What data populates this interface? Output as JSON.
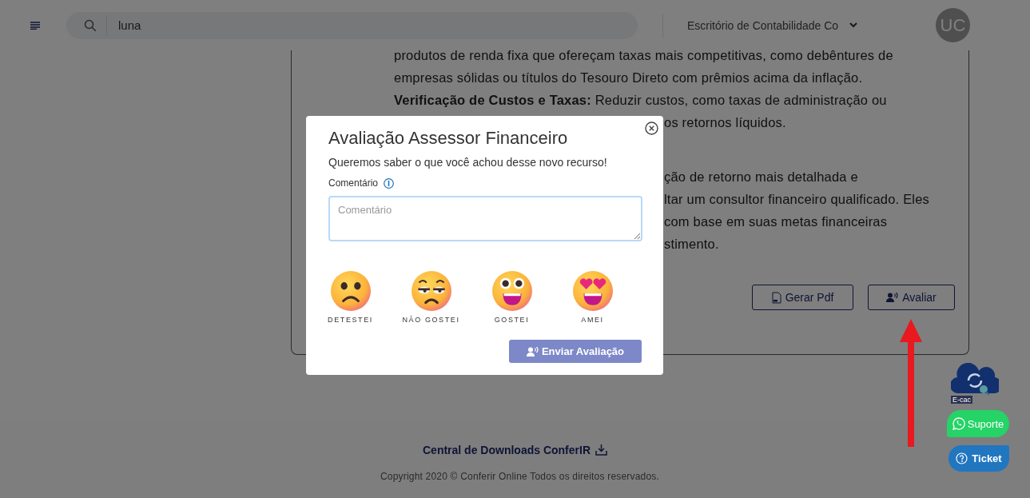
{
  "header": {
    "search": {
      "value": "luna"
    },
    "company_select": {
      "value": "Escritório de Contabilidade Co"
    },
    "avatar": {
      "initials": "UC"
    }
  },
  "article": {
    "lines": [
      {
        "kind": "full",
        "text": "produtos de renda fixa que ofereçam taxas mais competitivas, como debêntures de"
      },
      {
        "kind": "full",
        "text": "empresas sólidas ou títulos do Tesouro Direto com prêmios acima da inflação."
      },
      {
        "kind": "full",
        "text": "**Verificação de Custos e Taxas:** Reduzir custos, como taxas de administração ou"
      },
      {
        "kind": "partial",
        "text": "os retornos líquidos."
      },
      {
        "kind": "break"
      },
      {
        "kind": "partial",
        "text": "ção de retorno mais detalhada e"
      },
      {
        "kind": "partial",
        "text": "ltar um consultor financeiro qualificado. Eles"
      },
      {
        "kind": "partial",
        "text": "com base em suas metas financeiras"
      },
      {
        "kind": "partial",
        "text": "stimento."
      }
    ],
    "actions": [
      {
        "kind": "pdf",
        "label": "Gerar Pdf"
      },
      {
        "kind": "rate",
        "label": "Avaliar"
      }
    ]
  },
  "modal": {
    "title": "Avaliação Assessor Financeiro",
    "subtitle": "Queremos saber o que você achou desse novo recurso!",
    "comment_label": "Comentário",
    "comment_placeholder": "Comentário",
    "ratings": [
      {
        "kind": "frown",
        "label": "DETESTEI"
      },
      {
        "kind": "unamused",
        "label": "NÃO GOSTEI"
      },
      {
        "kind": "grin",
        "label": "GOSTEI"
      },
      {
        "kind": "hearts",
        "label": "AMEI"
      }
    ],
    "submit": "Enviar Avaliação"
  },
  "floating": {
    "ecac": "E-cac",
    "support": "Suporte",
    "ticket": "Ticket"
  },
  "footer": {
    "downloads_link": "Central de Downloads ConferIR",
    "copyright": "Copyright 2020 © Conferir Online Todos os direitos reservados."
  }
}
